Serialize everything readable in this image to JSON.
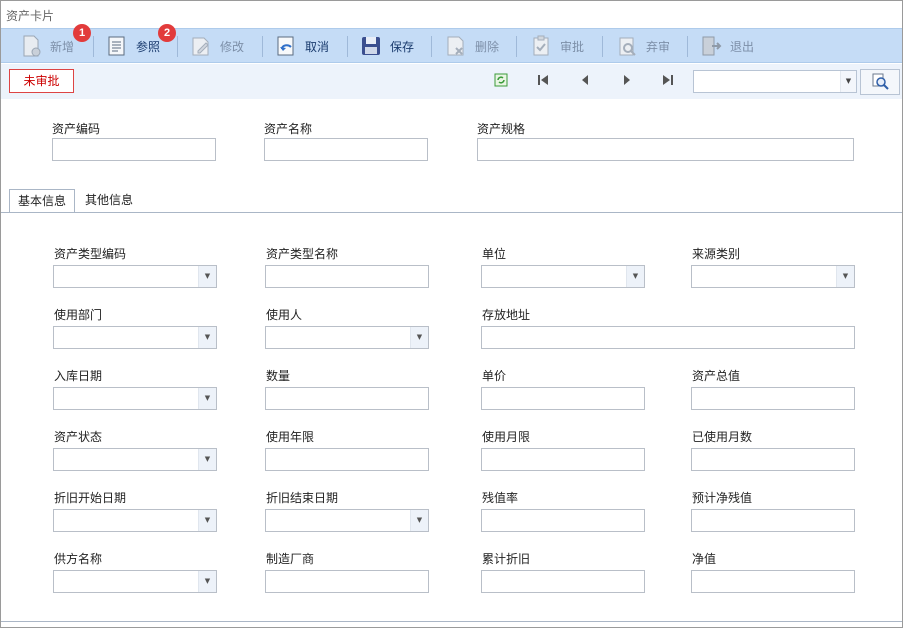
{
  "window": {
    "title": "资产卡片"
  },
  "toolbar": {
    "buttons": [
      {
        "label": "新增",
        "icon": "new-doc-icon",
        "enabled": false,
        "badge": "1"
      },
      {
        "label": "参照",
        "icon": "reference-doc-icon",
        "enabled": true,
        "badge": "2"
      },
      {
        "label": "修改",
        "icon": "edit-icon",
        "enabled": false
      },
      {
        "label": "取消",
        "icon": "undo-icon",
        "enabled": true
      },
      {
        "label": "保存",
        "icon": "floppy-disk-icon",
        "enabled": true
      },
      {
        "label": "删除",
        "icon": "delete-doc-icon",
        "enabled": false
      },
      {
        "label": "审批",
        "icon": "approve-clipboard-icon",
        "enabled": false
      },
      {
        "label": "弃审",
        "icon": "unapprove-search-icon",
        "enabled": false
      },
      {
        "label": "退出",
        "icon": "exit-door-icon",
        "enabled": false
      }
    ]
  },
  "status": {
    "approval": "未审批"
  },
  "header_fields": {
    "asset_code": {
      "label": "资产编码",
      "value": ""
    },
    "asset_name": {
      "label": "资产名称",
      "value": ""
    },
    "asset_spec": {
      "label": "资产规格",
      "value": ""
    }
  },
  "tabs": [
    {
      "label": "基本信息",
      "active": true
    },
    {
      "label": "其他信息",
      "active": false
    }
  ],
  "basic_info": {
    "asset_type_code": {
      "label": "资产类型编码",
      "value": ""
    },
    "asset_type_name": {
      "label": "资产类型名称",
      "value": ""
    },
    "unit": {
      "label": "单位",
      "value": ""
    },
    "source_type": {
      "label": "来源类别",
      "value": ""
    },
    "department": {
      "label": "使用部门",
      "value": ""
    },
    "user": {
      "label": "使用人",
      "value": ""
    },
    "location": {
      "label": "存放地址",
      "value": ""
    },
    "entry_date": {
      "label": "入库日期",
      "value": ""
    },
    "quantity": {
      "label": "数量",
      "value": ""
    },
    "unit_price": {
      "label": "单价",
      "value": ""
    },
    "total_value": {
      "label": "资产总值",
      "value": ""
    },
    "asset_status": {
      "label": "资产状态",
      "value": ""
    },
    "useful_life": {
      "label": "使用年限",
      "value": ""
    },
    "months_of_use": {
      "label": "使用月限",
      "value": ""
    },
    "months_used": {
      "label": "已使用月数",
      "value": ""
    },
    "dep_start_date": {
      "label": "折旧开始日期",
      "value": ""
    },
    "dep_end_date": {
      "label": "折旧结束日期",
      "value": ""
    },
    "residual_rate": {
      "label": "残值率",
      "value": ""
    },
    "est_net_residual": {
      "label": "预计净残值",
      "value": ""
    },
    "supplier_name": {
      "label": "供方名称",
      "value": ""
    },
    "manufacturer": {
      "label": "制造厂商",
      "value": ""
    },
    "accum_depreciation": {
      "label": "累计折旧",
      "value": ""
    },
    "net_value": {
      "label": "净值",
      "value": ""
    }
  },
  "colors": {
    "toolbar_bg": "#c5dcf6",
    "badge": "#e23b3b",
    "status_red": "#cc0000"
  }
}
